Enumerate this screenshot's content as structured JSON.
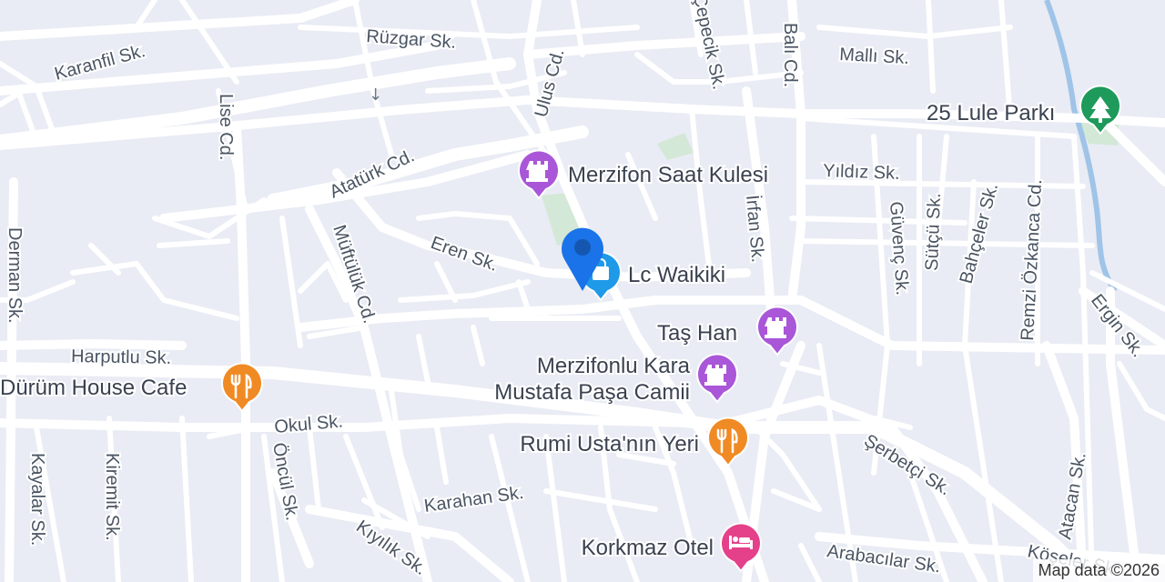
{
  "map": {
    "attribution": "Map data ©2026",
    "colors": {
      "land": "#e9ecf4",
      "road": "#ffffff",
      "park": "#d3e8d6",
      "water": "#9fc4e8",
      "landmark": "#a956d8",
      "restaurant": "#f08a24",
      "shopping": "#1e9ae8",
      "hotel": "#e4418a",
      "park_pin": "#1e9a5a",
      "location": "#1a73e8"
    }
  },
  "streets": {
    "karanfil": "Karanfil Sk.",
    "ruzgar": "Rüzgar Sk.",
    "ulus": "Ulus Cd.",
    "cepecik": "Çepecik Sk.",
    "bali": "Balı Cd.",
    "malli": "Mallı Sk.",
    "lise": "Lise Cd.",
    "ataturk": "Atatürk Cd.",
    "yildiz": "Yıldız Sk.",
    "irfan": "İrfan Sk.",
    "guvenc": "Güvenç Sk.",
    "sutcu": "Sütçü Sk.",
    "bahceler": "Bahçeler Sk.",
    "remzi": "Remzi Özkanca Cd.",
    "ergin": "Ergin Sk.",
    "eren": "Eren Sk.",
    "muftuluk": "Müftülük Cd.",
    "derman": "Derman Sk.",
    "harputlu": "Harputlu Sk.",
    "okul": "Okul Sk.",
    "kayalar": "Kayalar Sk.",
    "kiremit": "Kiremit Sk.",
    "oncul": "Öncül Sk.",
    "karahan": "Karahan Sk.",
    "kiyilik": "Kıyılık Sk.",
    "serbetci": "Şerbetçi Sk.",
    "atacan": "Atacan Sk.",
    "arabacilar": "Arabacılar Sk.",
    "koseler": "Köşeler Sk."
  },
  "pois": {
    "lule_parki": {
      "label": "25 Lule Parkı",
      "icon": "tree-icon",
      "category": "park"
    },
    "saat_kulesi": {
      "label": "Merzifon Saat Kulesi",
      "icon": "castle-icon",
      "category": "landmark"
    },
    "lc_waikiki": {
      "label": "Lc Waikiki",
      "icon": "shopping-bag-icon",
      "category": "shopping"
    },
    "tas_han": {
      "label": "Taş Han",
      "icon": "castle-icon",
      "category": "landmark"
    },
    "camii": {
      "label_line1": "Merzifonlu Kara",
      "label_line2": "Mustafa Paşa Camii",
      "icon": "castle-icon",
      "category": "landmark"
    },
    "durum_house": {
      "label": "Dürüm House Cafe",
      "icon": "restaurant-icon",
      "category": "restaurant"
    },
    "rumi_usta": {
      "label": "Rumi Usta'nın Yeri",
      "icon": "restaurant-icon",
      "category": "restaurant"
    },
    "korkmaz_otel": {
      "label": "Korkmaz Otel",
      "icon": "bed-icon",
      "category": "hotel"
    }
  }
}
